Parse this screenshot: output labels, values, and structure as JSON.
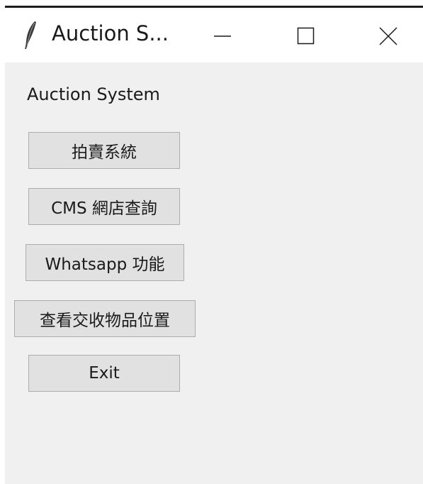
{
  "window": {
    "title": "Auction S...",
    "app_icon": "feather-icon",
    "controls": {
      "minimize": "minimize-icon",
      "maximize": "maximize-icon",
      "close": "close-icon"
    }
  },
  "main": {
    "heading": "Auction System",
    "buttons": {
      "auction": "拍賣系統",
      "cms": "CMS 網店查詢",
      "whatsapp": "Whatsapp 功能",
      "location": "查看交收物品位置",
      "exit": "Exit"
    }
  }
}
